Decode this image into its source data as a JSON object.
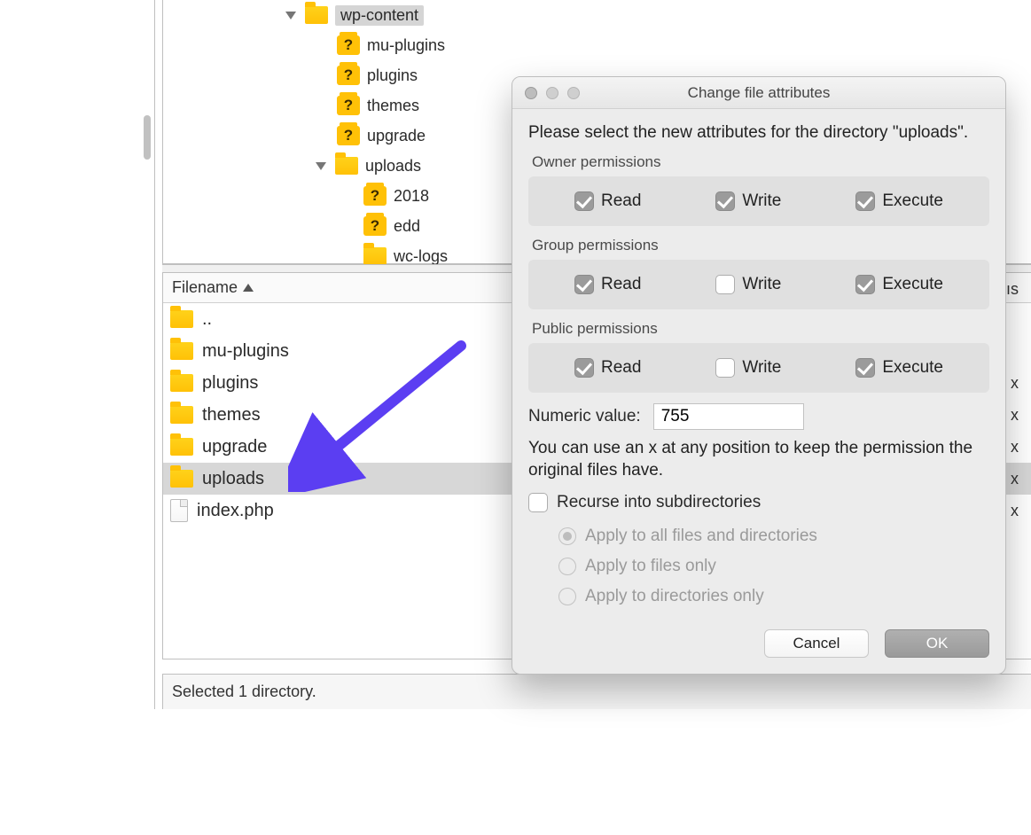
{
  "tree": {
    "root": {
      "label": "wp-content",
      "expanded": true
    },
    "items": [
      {
        "icon": "q",
        "label": "mu-plugins",
        "depth": 1
      },
      {
        "icon": "q",
        "label": "plugins",
        "depth": 1
      },
      {
        "icon": "q",
        "label": "themes",
        "depth": 1
      },
      {
        "icon": "q",
        "label": "upgrade",
        "depth": 1
      },
      {
        "icon": "folder",
        "label": "uploads",
        "depth": 1,
        "expanded": true
      },
      {
        "icon": "q",
        "label": "2018",
        "depth": 2
      },
      {
        "icon": "q",
        "label": "edd",
        "depth": 2
      },
      {
        "icon": "folder",
        "label": "wc-logs",
        "depth": 2
      }
    ]
  },
  "filelist": {
    "header": "Filename",
    "rows": [
      {
        "icon": "folder",
        "name": "..",
        "selected": false
      },
      {
        "icon": "folder",
        "name": "mu-plugins",
        "selected": false
      },
      {
        "icon": "folder",
        "name": "plugins",
        "selected": false
      },
      {
        "icon": "folder",
        "name": "themes",
        "selected": false
      },
      {
        "icon": "folder",
        "name": "upgrade",
        "selected": false
      },
      {
        "icon": "folder",
        "name": "uploads",
        "selected": true
      },
      {
        "icon": "page",
        "name": "index.php",
        "selected": false
      }
    ],
    "status": "Selected 1 directory."
  },
  "right_hints": {
    "header_tail": "ıs",
    "x": "x"
  },
  "dialog": {
    "title": "Change file attributes",
    "prompt": "Please select the new attributes for the directory \"uploads\".",
    "groups": {
      "owner": {
        "title": "Owner permissions",
        "read": true,
        "write": true,
        "execute": true
      },
      "group": {
        "title": "Group permissions",
        "read": true,
        "write": false,
        "execute": true
      },
      "public": {
        "title": "Public permissions",
        "read": true,
        "write": false,
        "execute": true
      }
    },
    "labels": {
      "read": "Read",
      "write": "Write",
      "execute": "Execute"
    },
    "numeric_label": "Numeric value:",
    "numeric_value": "755",
    "hint": "You can use an x at any position to keep the permission the original files have.",
    "recurse": {
      "label": "Recurse into subdirectories",
      "checked": false
    },
    "radios": {
      "all": "Apply to all files and directories",
      "files": "Apply to files only",
      "dirs": "Apply to directories only",
      "selected": "all"
    },
    "buttons": {
      "cancel": "Cancel",
      "ok": "OK"
    }
  }
}
